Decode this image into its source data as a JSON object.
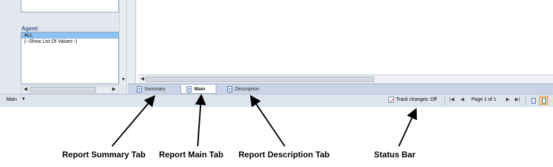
{
  "filter_panel": {
    "agent_label": "Agent:",
    "agent_options": [
      "ALL",
      "(--Show List Of Values--)"
    ],
    "selected_option": "ALL"
  },
  "tabs": [
    {
      "label": "Summary",
      "active": false
    },
    {
      "label": "Main",
      "active": true
    },
    {
      "label": "Description",
      "active": false
    }
  ],
  "status_bar": {
    "report_name": "Main",
    "track_changes": "Track changes: Off",
    "page_info": "Page 1 of 1"
  },
  "annotations": {
    "summary_tab": "Report Summary Tab",
    "main_tab": "Report Main Tab",
    "description_tab": "Report Description Tab",
    "status_bar": "Status Bar"
  },
  "icons": {
    "tab_icon": "document-icon",
    "track_changes_icon": "edit-document-icon",
    "nav": [
      "first-page-icon",
      "previous-page-icon",
      "next-page-icon",
      "last-page-icon"
    ],
    "views": [
      "page-view-icon",
      "document-view-icon"
    ]
  }
}
